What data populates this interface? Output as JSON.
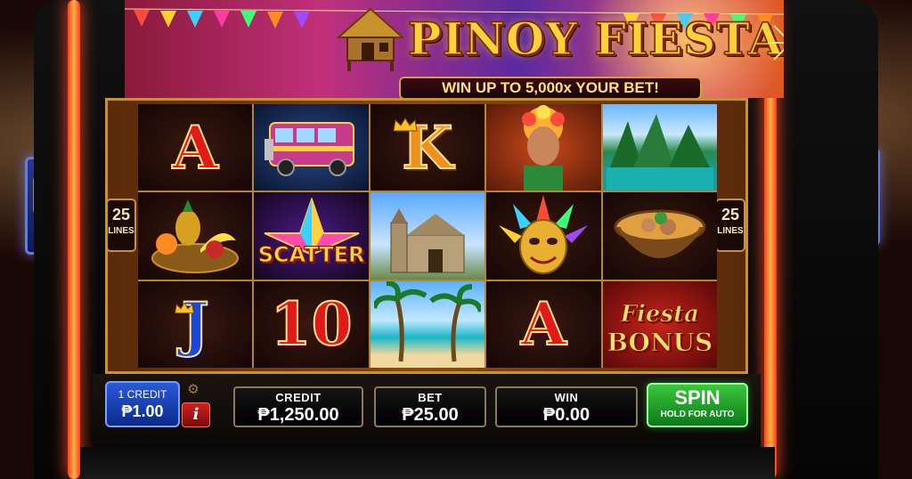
{
  "game": {
    "title": "PINOY FIESTA",
    "tagline": "WIN UP TO 5,000x YOUR BET!"
  },
  "paylines": {
    "left_count": "25",
    "left_label": "LINES",
    "right_count": "25",
    "right_label": "LINES"
  },
  "reels": [
    [
      "A",
      "jeepney",
      "K",
      "fiesta-woman",
      "karst-lagoon"
    ],
    [
      "fruit-basket",
      "scatter",
      "church",
      "fiesta-mask",
      "soup-bowl"
    ],
    [
      "J",
      "10",
      "beach-palms",
      "A",
      "fiesta-bonus"
    ]
  ],
  "symbols": {
    "letter_a": "A",
    "letter_k": "K",
    "letter_j": "J",
    "number_10": "10",
    "scatter": "SCATTER",
    "bonus_line1": "Fiesta",
    "bonus_line2": "BONUS"
  },
  "controls": {
    "credit_denom_label": "1 CREDIT",
    "credit_denom_value": "₱1.00",
    "info_label": "i",
    "settings_icon": "gear-icon",
    "credit_label": "CREDIT",
    "credit_value": "₱1,250.00",
    "bet_label": "BET",
    "bet_value": "₱25.00",
    "win_label": "WIN",
    "win_value": "₱0.00",
    "spin_label": "SPIN",
    "spin_sub": "HOLD FOR AUTO"
  },
  "colors": {
    "gold": "#ffd23a",
    "spin_green": "#2aa83a",
    "credit_blue": "#1a48d8",
    "info_red": "#c81a1a"
  }
}
